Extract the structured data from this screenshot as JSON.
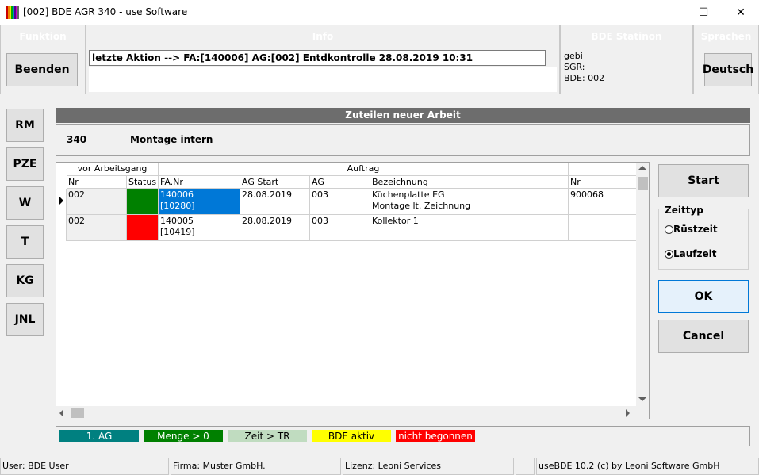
{
  "window": {
    "title": "[002] BDE AGR 340 - use Software",
    "minimize": "—",
    "maximize": "☐",
    "close": "✕"
  },
  "header": {
    "funktion": {
      "title": "Funktion",
      "button": "Beenden"
    },
    "info": {
      "title": "Info",
      "message": "letzte Aktion --> FA:[140006] AG:[002] Entdkontrolle 28.08.2019 10:31"
    },
    "station": {
      "title": "BDE Statinon",
      "user": "gebi",
      "sgr": "SGR:",
      "bde": "BDE: 002"
    },
    "sprachen": {
      "title": "Sprachen",
      "button": "Deutsch"
    }
  },
  "nav": [
    "RM",
    "PZE",
    "W",
    "T",
    "KG",
    "JNL"
  ],
  "section": {
    "title": "Zuteilen neuer Arbeit",
    "code": "340",
    "name": "Montage intern"
  },
  "grid": {
    "group_headers": {
      "prev": "vor Arbeitsgang",
      "order": "Auftrag"
    },
    "columns": [
      "Nr",
      "Status",
      "FA.Nr",
      "AG Start",
      "AG",
      "Bezeichnung",
      "Nr"
    ],
    "rows": [
      {
        "nr": "002",
        "status_color": "#008000",
        "fa1": "140006",
        "fa2": "[10280]",
        "start": "28.08.2019",
        "ag": "003",
        "bez1": "Küchenplatte EG",
        "bez2": "Montage lt. Zeichnung",
        "nr2": "900068"
      },
      {
        "nr": "002",
        "status_color": "#ff0000",
        "fa1": "140005",
        "fa2": "[10419]",
        "start": "28.08.2019",
        "ag": "003",
        "bez1": "Kollektor 1",
        "bez2": "",
        "nr2": ""
      }
    ]
  },
  "right": {
    "start": "Start",
    "zeittyp_title": "Zeittyp",
    "ruestzeit": "Rüstzeit",
    "laufzeit": "Laufzeit",
    "ok": "OK",
    "cancel": "Cancel"
  },
  "legend": [
    {
      "label": "1. AG",
      "bg": "#008080",
      "fg": "#ffffff"
    },
    {
      "label": "Menge > 0",
      "bg": "#008000",
      "fg": "#ffffff"
    },
    {
      "label": "Zeit > TR",
      "bg": "#c0dcc0",
      "fg": "#000000"
    },
    {
      "label": "BDE aktiv",
      "bg": "#ffff00",
      "fg": "#000000"
    },
    {
      "label": "nicht begonnen",
      "bg": "#ff0000",
      "fg": "#ffffff"
    }
  ],
  "statusbar": {
    "user": "User: BDE User",
    "firma": "Firma: Muster GmbH.",
    "lizenz": "Lizenz: Leoni Services",
    "empty": "",
    "version": "useBDE 10.2 (c) by Leoni Software GmbH"
  }
}
